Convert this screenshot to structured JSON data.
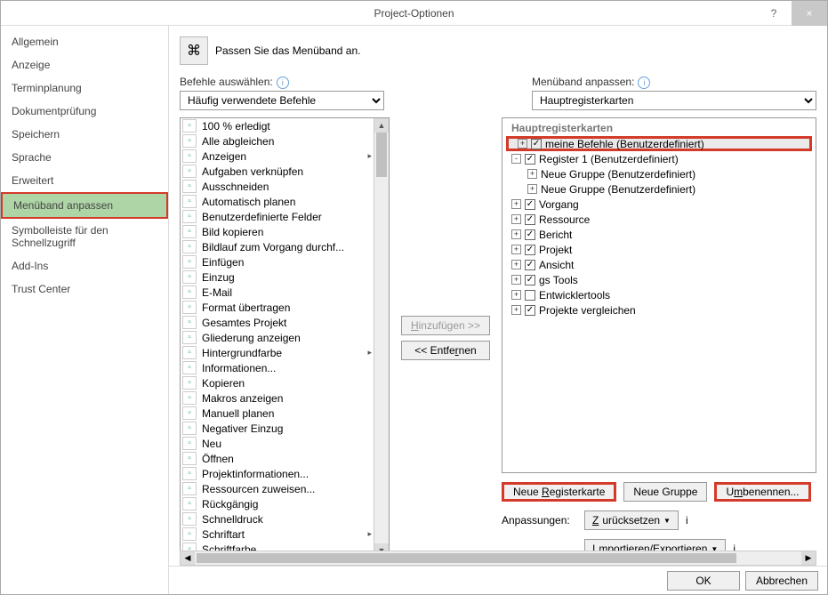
{
  "window": {
    "title": "Project-Optionen"
  },
  "titlebar_icons": {
    "help": "?",
    "close": "×"
  },
  "sidebar": {
    "items": [
      {
        "label": "Allgemein"
      },
      {
        "label": "Anzeige"
      },
      {
        "label": "Terminplanung"
      },
      {
        "label": "Dokumentprüfung"
      },
      {
        "label": "Speichern"
      },
      {
        "label": "Sprache"
      },
      {
        "label": "Erweitert"
      },
      {
        "label": "Menüband anpassen",
        "selected": true
      },
      {
        "label": "Symbolleiste für den Schnellzugriff"
      },
      {
        "label": "Add-Ins"
      },
      {
        "label": "Trust Center"
      }
    ]
  },
  "header": {
    "text": "Passen Sie das Menüband an."
  },
  "left_section_label": "Befehle auswählen:",
  "left_combo": {
    "selected": "Häufig verwendete Befehle"
  },
  "right_section_label": "Menüband anpassen:",
  "right_combo": {
    "selected": "Hauptregisterkarten"
  },
  "commands": [
    "100 % erledigt",
    "Alle abgleichen",
    "Anzeigen",
    "Aufgaben verknüpfen",
    "Ausschneiden",
    "Automatisch planen",
    "Benutzerdefinierte Felder",
    "Bild kopieren",
    "Bildlauf zum Vorgang durchf...",
    "Einfügen",
    "Einzug",
    "E-Mail",
    "Format übertragen",
    "Gesamtes Projekt",
    "Gliederung anzeigen",
    "Hintergrundfarbe",
    "Informationen...",
    "Kopieren",
    "Makros anzeigen",
    "Manuell planen",
    "Negativer Einzug",
    "Neu",
    "Öffnen",
    "Projektinformationen...",
    "Ressourcen zuweisen...",
    "Rückgängig",
    "Schnelldruck",
    "Schriftart",
    "Schriftfarbe"
  ],
  "command_arrows": {
    "2": true,
    "15": true,
    "27": true
  },
  "mid_buttons": {
    "add": "Hinzufügen >>",
    "remove": "<< Entfernen"
  },
  "tree": {
    "title": "Hauptregisterkarten",
    "nodes": [
      {
        "indent": 0,
        "expando": "+",
        "checked": true,
        "label": "meine Befehle (Benutzerdefiniert)",
        "highlighted": true
      },
      {
        "indent": 0,
        "expando": "-",
        "checked": true,
        "label": "Register 1 (Benutzerdefiniert)"
      },
      {
        "indent": 1,
        "expando": "+",
        "label": "Neue Gruppe (Benutzerdefiniert)"
      },
      {
        "indent": 1,
        "expando": "+",
        "label": "Neue Gruppe (Benutzerdefiniert)"
      },
      {
        "indent": 0,
        "expando": "+",
        "checked": true,
        "label": "Vorgang"
      },
      {
        "indent": 0,
        "expando": "+",
        "checked": true,
        "label": "Ressource"
      },
      {
        "indent": 0,
        "expando": "+",
        "checked": true,
        "label": "Bericht"
      },
      {
        "indent": 0,
        "expando": "+",
        "checked": true,
        "label": "Projekt"
      },
      {
        "indent": 0,
        "expando": "+",
        "checked": true,
        "label": "Ansicht"
      },
      {
        "indent": 0,
        "expando": "+",
        "checked": true,
        "label": "gs Tools"
      },
      {
        "indent": 0,
        "expando": "+",
        "checked": false,
        "label": "Entwicklertools"
      },
      {
        "indent": 0,
        "expando": "+",
        "checked": true,
        "label": "Projekte vergleichen"
      }
    ]
  },
  "right_buttons": {
    "new_tab": "Neue Registerkarte",
    "new_group": "Neue Gruppe",
    "rename": "Umbenennen..."
  },
  "customizations": {
    "label": "Anpassungen:",
    "reset": "Zurücksetzen",
    "import_export": "Importieren/Exportieren"
  },
  "footer": {
    "ok": "OK",
    "cancel": "Abbrechen"
  }
}
